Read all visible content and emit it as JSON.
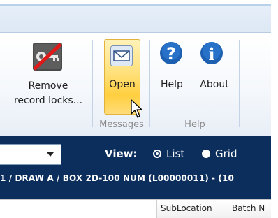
{
  "ribbon": {
    "remove_locks_label_line1": "Remove",
    "remove_locks_label_line2": "record locks...",
    "open_label": "Open",
    "help_label": "Help",
    "about_label": "About",
    "group_messages": "Messages",
    "group_help": "Help"
  },
  "view_bar": {
    "view_label": "View:",
    "option_list": "List",
    "option_grid": "Grid",
    "selected": "List",
    "path_text": "1 / DRAW A / BOX 2D-100 NUM  (L00000011)  -  (10"
  },
  "table": {
    "columns": [
      "SubLocation",
      "Batch N"
    ]
  },
  "colors": {
    "navy": "#0b2e5c",
    "open_highlight": "#ffd95a",
    "help_blue": "#1d5fb0"
  },
  "icons": [
    "lock-strike-icon",
    "envelope-icon",
    "help-icon",
    "info-icon",
    "cursor-icon",
    "dropdown-arrow-icon"
  ]
}
